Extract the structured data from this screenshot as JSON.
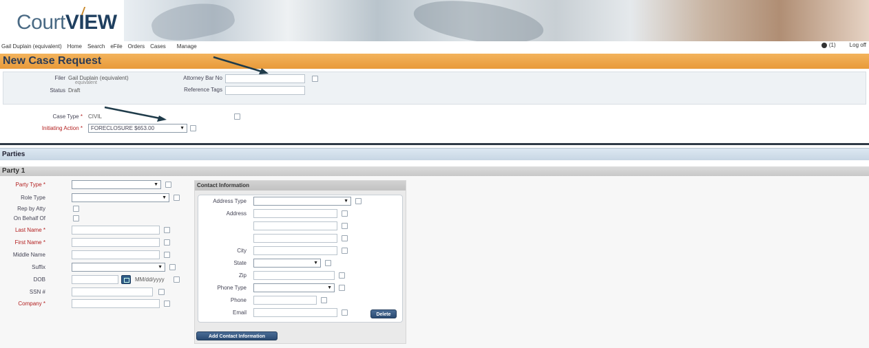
{
  "app": {
    "logo_part1": "Court",
    "logo_part2": "VIEW"
  },
  "nav": {
    "user": "Gail Duplain (equivalent)",
    "links": [
      "Home",
      "Search",
      "eFile",
      "Orders",
      "Cases",
      "Manage"
    ],
    "notif_count": "(1)",
    "logout": "Log off"
  },
  "page": {
    "title": "New Case Request"
  },
  "filer": {
    "filer_label": "Filer",
    "filer_value": "Gail Duplain (equivalent)",
    "filer_value2": "equivalent",
    "status_label": "Status",
    "status_value": "Draft",
    "attorney_label": "Attorney Bar No",
    "reference_label": "Reference Tags"
  },
  "case": {
    "case_type_label": "Case Type",
    "case_type_value": "CIVIL",
    "initiating_label": "Initiating Action",
    "initiating_value": "FORECLOSURE $653.00"
  },
  "parties": {
    "section_title": "Parties",
    "party_title": "Party 1"
  },
  "party_fields": {
    "party_type": "Party Type",
    "role_type": "Role Type",
    "rep_by_atty": "Rep by Atty",
    "on_behalf_of": "On Behalf Of",
    "last_name": "Last Name",
    "first_name": "First Name",
    "middle_name": "Middle Name",
    "suffix": "Suffix",
    "dob": "DOB",
    "dob_hint": "MM/dd/yyyy",
    "ssn": "SSN #",
    "company": "Company"
  },
  "contact": {
    "title": "Contact Information",
    "address_type": "Address Type",
    "address": "Address",
    "city": "City",
    "state": "State",
    "zip": "Zip",
    "phone_type": "Phone Type",
    "phone": "Phone",
    "email": "Email",
    "delete_btn": "Delete",
    "add_btn": "Add Contact Information"
  },
  "required_marker": "*",
  "colors": {
    "title_bar": "#e89a3a",
    "parties_bar": "#c7d6e4",
    "required": "#b21e1e",
    "button": "#2a4a72"
  }
}
